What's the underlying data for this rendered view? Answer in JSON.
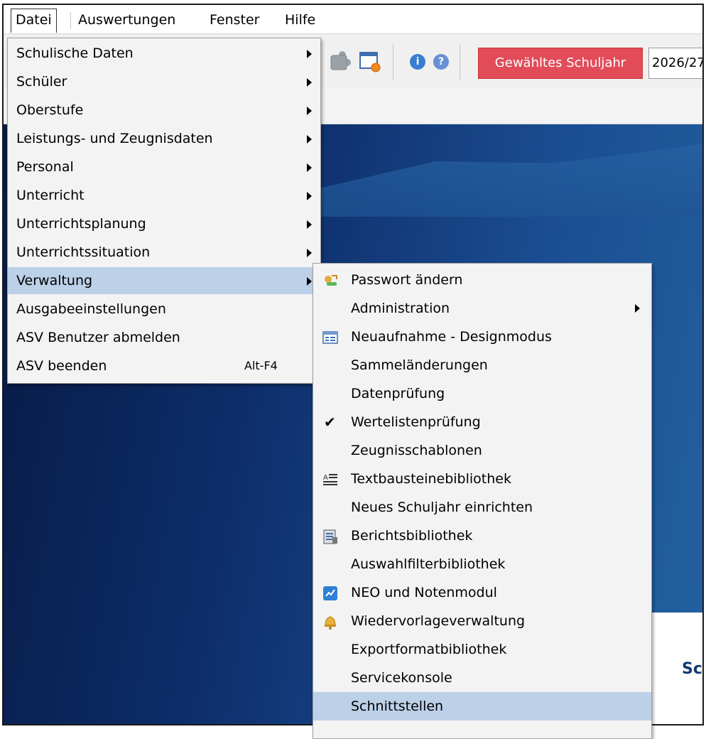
{
  "menubar": {
    "datei": "Datei",
    "auswertungen": "Auswertungen",
    "fenster": "Fenster",
    "hilfe": "Hilfe"
  },
  "toolbar": {
    "schuljahr_label": "Gewähltes Schuljahr",
    "schuljahr_value": "2026/27"
  },
  "background": {
    "panel_text": "Sc"
  },
  "datei_menu": {
    "items": [
      {
        "label": "Schulische Daten",
        "submenu": true
      },
      {
        "label": "Schüler",
        "submenu": true
      },
      {
        "label": "Oberstufe",
        "submenu": true
      },
      {
        "label": "Leistungs- und Zeugnisdaten",
        "submenu": true
      },
      {
        "label": "Personal",
        "submenu": true
      },
      {
        "label": "Unterricht",
        "submenu": true
      },
      {
        "label": "Unterrichtsplanung",
        "submenu": true
      },
      {
        "label": "Unterrichtssituation",
        "submenu": true
      },
      {
        "label": "Verwaltung",
        "submenu": true,
        "highlighted": true
      },
      {
        "label": "Ausgabeeinstellungen"
      },
      {
        "label": "ASV Benutzer abmelden"
      },
      {
        "label": "ASV beenden",
        "shortcut": "Alt-F4"
      }
    ]
  },
  "verwaltung_menu": {
    "items": [
      {
        "label": "Passwort ändern",
        "icon": "key-user-icon"
      },
      {
        "label": "Administration",
        "submenu": true
      },
      {
        "label": "Neuaufnahme - Designmodus",
        "icon": "form-design-icon"
      },
      {
        "label": "Sammeländerungen"
      },
      {
        "label": "Datenprüfung"
      },
      {
        "label": "Wertelistenprüfung",
        "checked": true
      },
      {
        "label": "Zeugnisschablonen"
      },
      {
        "label": "Textbausteinebibliothek",
        "icon": "text-blocks-icon"
      },
      {
        "label": "Neues Schuljahr einrichten"
      },
      {
        "label": "Berichtsbibliothek",
        "icon": "report-library-icon"
      },
      {
        "label": "Auswahlfilterbibliothek"
      },
      {
        "label": "NEO und Notenmodul",
        "icon": "neo-module-icon"
      },
      {
        "label": "Wiedervorlageverwaltung",
        "icon": "bell-icon"
      },
      {
        "label": "Exportformatbibliothek"
      },
      {
        "label": "Servicekonsole"
      },
      {
        "label": "Schnittstellen",
        "highlighted": true
      }
    ]
  },
  "colors": {
    "menu_bg": "#f3f3f3",
    "highlight": "#bcd0e8",
    "schuljahr_button": "#e24c59",
    "background_dark": "#0d2d69"
  }
}
